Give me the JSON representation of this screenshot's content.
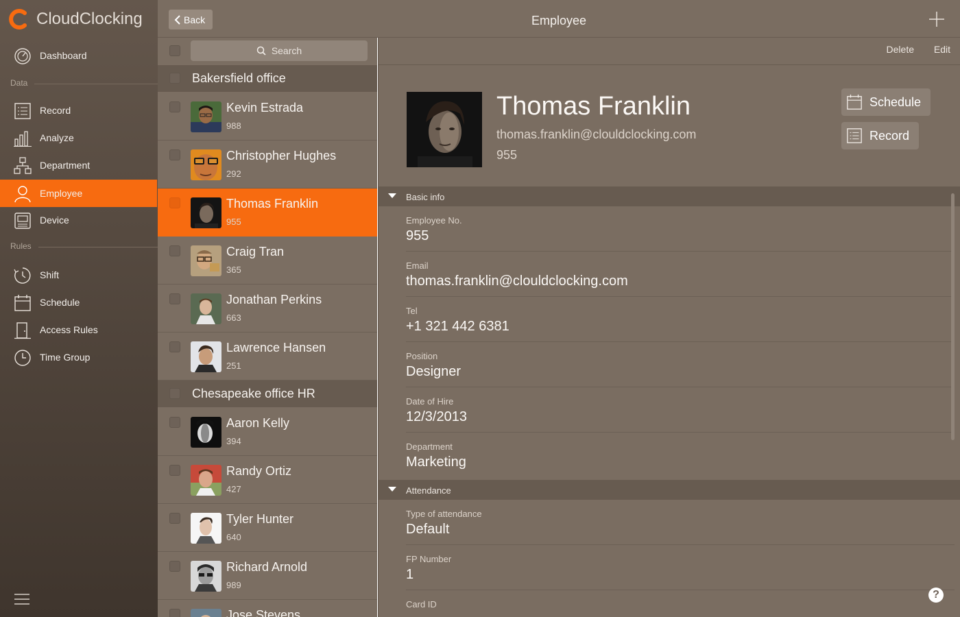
{
  "app": {
    "name": "CloudClocking"
  },
  "sidebar": {
    "items": [
      {
        "label": "Dashboard",
        "icon": "dashboard-icon"
      },
      {
        "label": "Record",
        "icon": "list-icon"
      },
      {
        "label": "Analyze",
        "icon": "bar-chart-icon"
      },
      {
        "label": "Department",
        "icon": "org-chart-icon"
      },
      {
        "label": "Employee",
        "icon": "person-icon",
        "active": true
      },
      {
        "label": "Device",
        "icon": "device-icon"
      },
      {
        "label": "Shift",
        "icon": "shift-clock-icon"
      },
      {
        "label": "Schedule",
        "icon": "calendar-icon"
      },
      {
        "label": "Access Rules",
        "icon": "door-icon"
      },
      {
        "label": "Time Group",
        "icon": "clock-icon"
      }
    ],
    "sections": [
      "Data",
      "Rules"
    ]
  },
  "header": {
    "back_label": "Back",
    "title": "Employee"
  },
  "list": {
    "search_placeholder": "Search",
    "groups": [
      {
        "name": "Bakersfield office",
        "employees": [
          {
            "name": "Kevin Estrada",
            "id": "988"
          },
          {
            "name": "Christopher Hughes",
            "id": "292"
          },
          {
            "name": "Thomas Franklin",
            "id": "955",
            "selected": true
          },
          {
            "name": "Craig Tran",
            "id": "365"
          },
          {
            "name": "Jonathan Perkins",
            "id": "663"
          },
          {
            "name": "Lawrence Hansen",
            "id": "251"
          }
        ]
      },
      {
        "name": "Chesapeake office HR",
        "employees": [
          {
            "name": "Aaron Kelly",
            "id": "394"
          },
          {
            "name": "Randy Ortiz",
            "id": "427"
          },
          {
            "name": "Tyler Hunter",
            "id": "640"
          },
          {
            "name": "Richard Arnold",
            "id": "989"
          },
          {
            "name": "Jose Stevens",
            "id": ""
          }
        ]
      }
    ]
  },
  "detail": {
    "delete_label": "Delete",
    "edit_label": "Edit",
    "name": "Thomas Franklin",
    "email": "thomas.franklin@clouldclocking.com",
    "number": "955",
    "schedule_label": "Schedule",
    "record_label": "Record",
    "sections": [
      {
        "title": "Basic info",
        "fields": [
          {
            "label": "Employee No.",
            "value": "955"
          },
          {
            "label": "Email",
            "value": "thomas.franklin@clouldclocking.com"
          },
          {
            "label": "Tel",
            "value": "+1 321 442 6381"
          },
          {
            "label": "Position",
            "value": "Designer"
          },
          {
            "label": "Date of Hire",
            "value": "12/3/2013"
          },
          {
            "label": "Department",
            "value": "Marketing"
          }
        ]
      },
      {
        "title": "Attendance",
        "fields": [
          {
            "label": "Type of attendance",
            "value": "Default"
          },
          {
            "label": "FP Number",
            "value": "1"
          },
          {
            "label": "Card ID",
            "value": ""
          }
        ]
      }
    ],
    "help_label": "?"
  },
  "colors": {
    "accent": "#f76b10",
    "sidebar": "#5a4e44",
    "panel": "#7b6e62",
    "header": "#675b50"
  }
}
